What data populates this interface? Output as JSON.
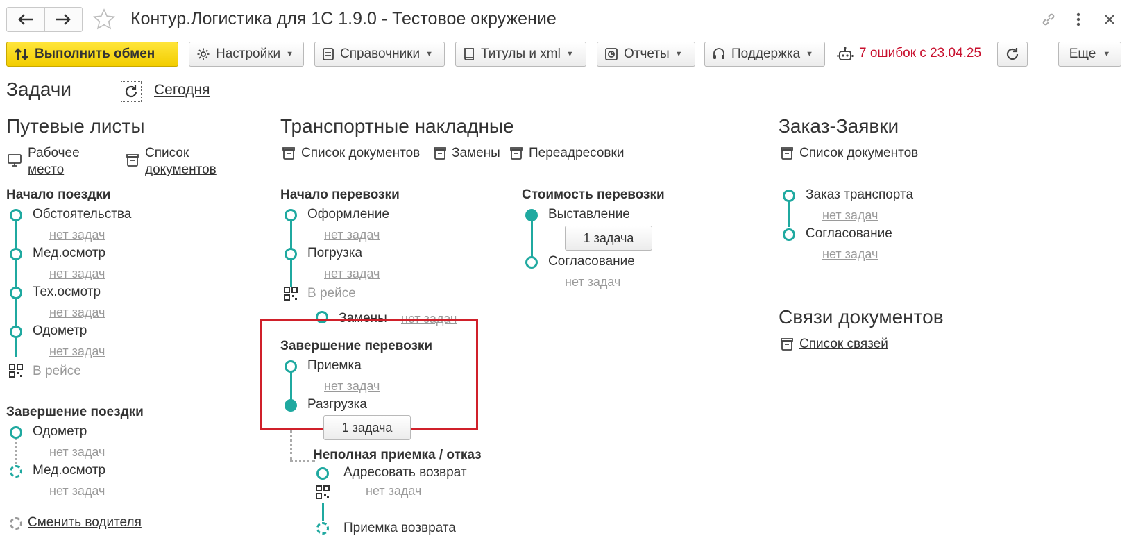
{
  "window": {
    "title": "Контур.Логистика для 1С 1.9.0 - Тестовое окружение"
  },
  "toolbar": {
    "exchange": "Выполнить обмен",
    "settings": "Настройки",
    "references": "Справочники",
    "titles": "Титулы и xml",
    "reports": "Отчеты",
    "support": "Поддержка",
    "errors": "7 ошибок с 23.04.25",
    "more": "Еще"
  },
  "header": {
    "title": "Задачи",
    "today": "Сегодня"
  },
  "waybills": {
    "title": "Путевые листы",
    "workplace_line1": "Рабочее",
    "workplace_line2": "место",
    "list_line1": "Список",
    "list_line2": "документов",
    "start": {
      "title": "Начало поездки",
      "steps": [
        "Обстоятельства",
        "Мед.осмотр",
        "Тех.осмотр",
        "Одометр"
      ],
      "no_tasks": "нет задач",
      "in_trip": "В рейсе"
    },
    "finish": {
      "title": "Завершение поездки",
      "steps": [
        "Одометр",
        "Мед.осмотр"
      ],
      "no_tasks": "нет задач"
    },
    "change_driver": "Сменить водителя"
  },
  "transport": {
    "title": "Транспортные накладные",
    "doc_list": "Список документов",
    "replacements": "Замены",
    "readdress": "Переадресовки",
    "start": {
      "title": "Начало перевозки",
      "steps": [
        "Оформление",
        "Погрузка"
      ],
      "no_tasks": "нет задач",
      "in_trip": "В рейсе",
      "replacements": "Замены"
    },
    "finish": {
      "title": "Завершение перевозки",
      "steps": [
        "Приемка",
        "Разгрузка"
      ],
      "no_tasks": "нет задач",
      "task_button": "1 задача"
    },
    "partial": {
      "title": "Неполная приемка / отказ",
      "address_return": "Адресовать возврат",
      "no_tasks": "нет задач",
      "return_acceptance": "Приемка возврата"
    },
    "cost": {
      "title": "Стоимость перевозки",
      "steps": [
        "Выставление",
        "Согласование"
      ],
      "task_button": "1 задача",
      "no_tasks": "нет задач"
    }
  },
  "orders": {
    "title": "Заказ-Заявки",
    "doc_list": "Список документов",
    "steps": [
      "Заказ транспорта",
      "Согласование"
    ],
    "no_tasks": "нет задач"
  },
  "links": {
    "title": "Связи документов",
    "list": "Список связей"
  },
  "colors": {
    "accent": "#1fa9a0",
    "primary_button": "#ffd800",
    "error": "#c8102e",
    "highlight": "#d0202a"
  }
}
